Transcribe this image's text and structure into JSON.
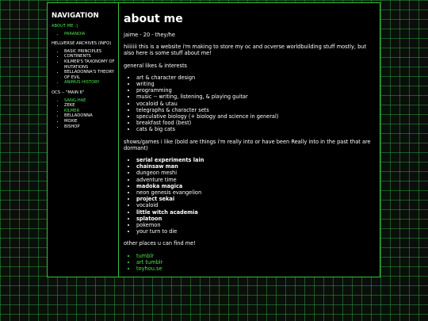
{
  "sidebar": {
    "title": "NAVIGATION",
    "about_link": "ABOUT ME :]",
    "paranoia_link": "PARANOIA",
    "archives_heading": "HELLVERSE ARCHIVES (INFO)",
    "archives_items": [
      {
        "label": "BASIC PRINCIPLES",
        "link": false
      },
      {
        "label": "CONTINENTS",
        "link": false
      },
      {
        "label": "KILMER'S TAXONOMY OF MUTATIONS",
        "link": false
      },
      {
        "label": "BELLADONNA'S THEORY OF EVIL",
        "link": false
      },
      {
        "label": "ANIMUS HISTORY",
        "link": true
      }
    ],
    "ocs_heading": "OCS -- \"MAIN 6\"",
    "ocs_items": [
      {
        "label": "SANG-HAE",
        "link": true
      },
      {
        "label": "ZEKE",
        "link": false
      },
      {
        "label": "KILMER",
        "link": true
      },
      {
        "label": "BELLADONNA",
        "link": false
      },
      {
        "label": "MOXIE",
        "link": false
      },
      {
        "label": "BISHOP",
        "link": false
      }
    ]
  },
  "main": {
    "title": "about me",
    "intro": "jaime - 20 - they/he",
    "description": "hiiiiiii this is a website i'm making to store my oc and ocverse worldbuilding stuff mostly, but also here is some stuff about me!",
    "likes_heading": "general likes & interests",
    "likes": [
      "art & character design",
      "writing",
      "programming",
      "music -- writing, listening, & playing guitar",
      "vocaloid & utau",
      "telegraphs & character sets",
      "speculative biology (+ biology and science in general)",
      "breakfast food (best)",
      "cats & big cats"
    ],
    "shows_heading": "shows/games i like (bold are things i'm really into or have been Really into in the past that are dormant)",
    "shows": [
      {
        "label": "serial experiments lain",
        "bold": true
      },
      {
        "label": "chainsaw man",
        "bold": true
      },
      {
        "label": "dungeon meshi",
        "bold": false
      },
      {
        "label": "adventure time",
        "bold": false
      },
      {
        "label": "madoka magica",
        "bold": true
      },
      {
        "label": "neon genesis evangelion",
        "bold": false
      },
      {
        "label": "project sekai",
        "bold": true
      },
      {
        "label": "vocaloid",
        "bold": false
      },
      {
        "label": "little witch academia",
        "bold": true
      },
      {
        "label": "splatoon",
        "bold": true
      },
      {
        "label": "pokemon",
        "bold": false
      },
      {
        "label": "your turn to die",
        "bold": false
      }
    ],
    "places_heading": "other places u can find me!",
    "places": [
      "tumblr",
      "art tumblr",
      "toyhou.se"
    ]
  },
  "colors": {
    "accent": "#4ee44e",
    "border": "#34c23a",
    "background": "#000000",
    "grid": "#289640"
  }
}
